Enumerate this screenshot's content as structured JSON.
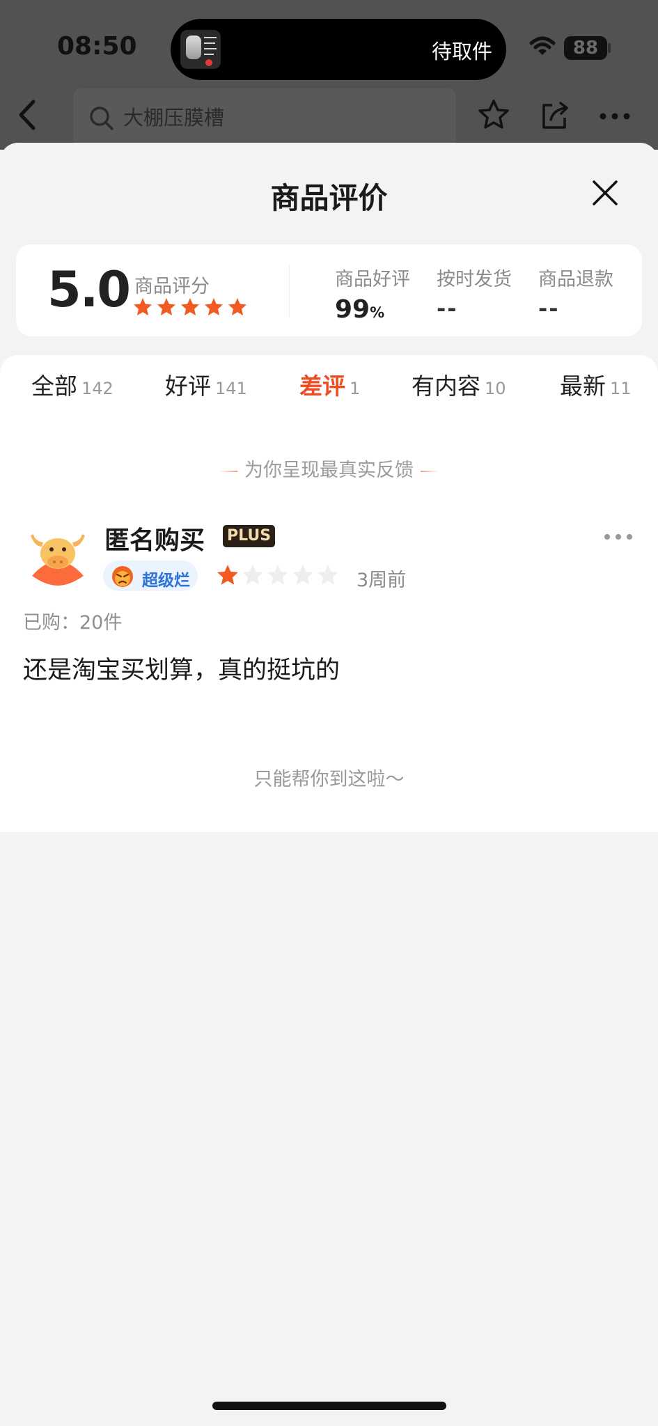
{
  "status_bar": {
    "time": "08:50",
    "island_text": "待取件",
    "battery": "88"
  },
  "top_bar": {
    "search_placeholder": "大棚压膜槽"
  },
  "sheet": {
    "title": "商品评价"
  },
  "summary": {
    "score": "5.0",
    "score_label": "商品评分",
    "score_stars": 5,
    "metrics": [
      {
        "label": "商品好评",
        "value": "99",
        "unit": "%"
      },
      {
        "label": "按时发货",
        "value": "--"
      },
      {
        "label": "商品退款",
        "value": "--"
      }
    ]
  },
  "tabs": [
    {
      "label": "全部",
      "count": "142"
    },
    {
      "label": "好评",
      "count": "141"
    },
    {
      "label": "差评",
      "count": "1",
      "active": true
    },
    {
      "label": "有内容",
      "count": "10"
    },
    {
      "label": "最新",
      "count": "11"
    }
  ],
  "feedback_note": "为你呈现最真实反馈",
  "review": {
    "name": "匿名购买",
    "badge": "PLUS",
    "level": "超级烂",
    "rating": 1,
    "time": "3周前",
    "purchased": "已购：20件",
    "text": "还是淘宝买划算，真的挺坑的"
  },
  "end_note": "只能帮你到这啦～",
  "colors": {
    "accent": "#ef4b20",
    "star_on": "#f25a22",
    "star_off": "#eeeeee",
    "level_text": "#2d73d9"
  }
}
